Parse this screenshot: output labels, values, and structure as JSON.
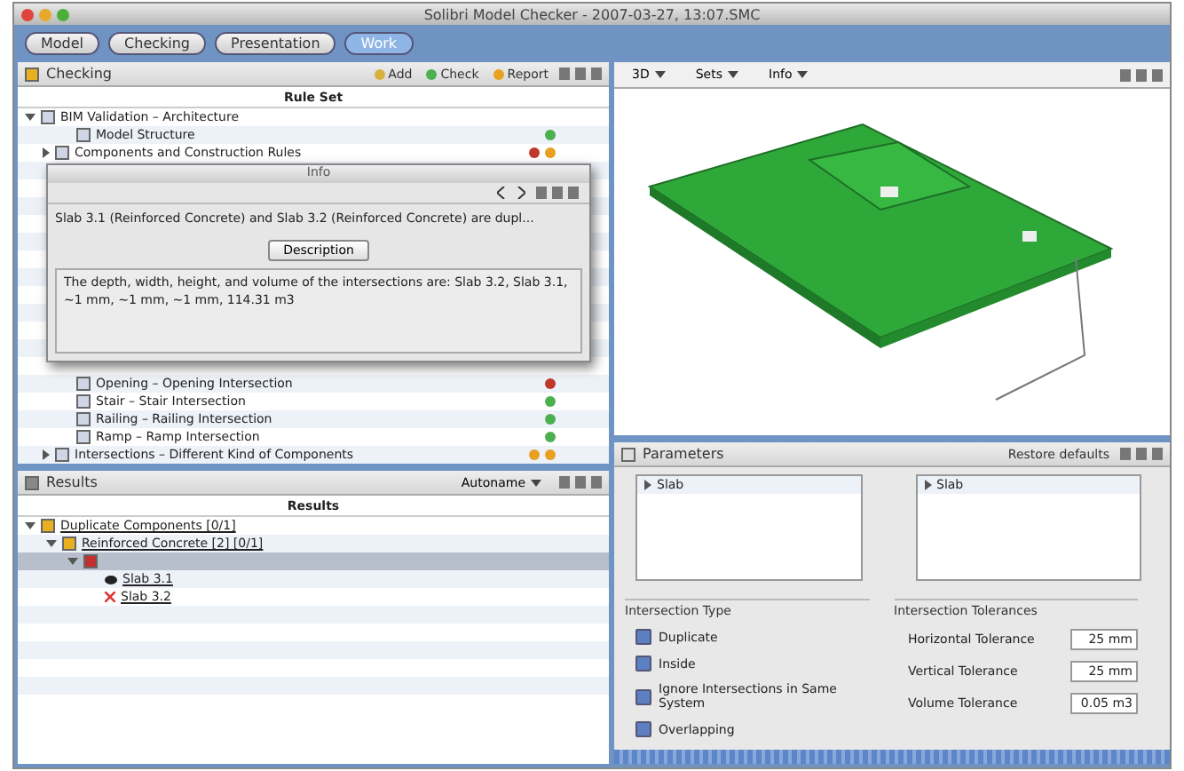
{
  "window": {
    "title": "Solibri Model Checker - 2007-03-27, 13:07.SMC"
  },
  "tabs": [
    {
      "label": "Model",
      "selected": false
    },
    {
      "label": "Checking",
      "selected": false
    },
    {
      "label": "Presentation",
      "selected": false
    },
    {
      "label": "Work",
      "selected": true
    }
  ],
  "checking": {
    "title": "Checking",
    "actions": [
      "Add",
      "Check",
      "Report"
    ],
    "column": "Rule Set",
    "rules": [
      {
        "label": "BIM Validation – Architecture",
        "expanded": true,
        "children": [
          {
            "label": "Model Structure",
            "status": [
              {
                "color": "#4caf50"
              }
            ]
          },
          {
            "label": "Components and Construction Rules",
            "expanded": false,
            "status": [
              {
                "color": "#c0392b"
              },
              {
                "color": "#e8a020"
              }
            ]
          },
          {
            "label": "Opening – Opening Intersection",
            "status": [
              {
                "color": "#c0392b"
              }
            ]
          },
          {
            "label": "Stair – Stair Intersection",
            "status": [
              {
                "color": "#4caf50"
              }
            ]
          },
          {
            "label": "Railing – Railing Intersection",
            "status": [
              {
                "color": "#4caf50"
              }
            ]
          },
          {
            "label": "Ramp – Ramp Intersection",
            "status": [
              {
                "color": "#4caf50"
              }
            ]
          },
          {
            "label": "Intersections – Different Kind of Components",
            "expanded": false,
            "status": [
              {
                "color": "#e8a020"
              },
              {
                "color": "#e8a020"
              }
            ]
          }
        ]
      }
    ]
  },
  "info": {
    "title": "Info",
    "message": "Slab 3.1 (Reinforced Concrete) and Slab 3.2 (Reinforced Concrete) are dupl...",
    "button": "Description",
    "description": "The depth, width, height, and volume of the intersections are: Slab 3.2, Slab 3.1, ~1 mm, ~1 mm, ~1 mm, 114.31 m3"
  },
  "results": {
    "title": "Results",
    "dropdown": "Autoname",
    "column": "Results",
    "tree": [
      {
        "label": "Duplicate Components [0/1]",
        "expanded": true,
        "children": [
          {
            "label": "Reinforced Concrete [2] [0/1]",
            "expanded": true,
            "children": [
              {
                "selected": true,
                "expanded": true,
                "children": [
                  {
                    "label": "Slab 3.1",
                    "kind": "visible"
                  },
                  {
                    "label": "Slab 3.2",
                    "kind": "hidden"
                  }
                ]
              }
            ]
          }
        ]
      }
    ]
  },
  "view3d": {
    "toolbar": [
      "3D",
      "Sets",
      "Info"
    ]
  },
  "parameters": {
    "title": "Parameters",
    "restore": "Restore defaults",
    "lists": [
      "Slab",
      "Slab"
    ],
    "types_title": "Intersection Type",
    "types": [
      {
        "label": "Duplicate",
        "checked": true
      },
      {
        "label": "Inside",
        "checked": true
      },
      {
        "label": "Ignore Intersections in Same System",
        "checked": true
      },
      {
        "label": "Overlapping",
        "checked": true
      }
    ],
    "tolerances_title": "Intersection Tolerances",
    "tolerances": [
      {
        "label": "Horizontal Tolerance",
        "value": "25 mm"
      },
      {
        "label": "Vertical Tolerance",
        "value": "25 mm"
      },
      {
        "label": "Volume Tolerance",
        "value": "0.05 m3"
      }
    ]
  }
}
